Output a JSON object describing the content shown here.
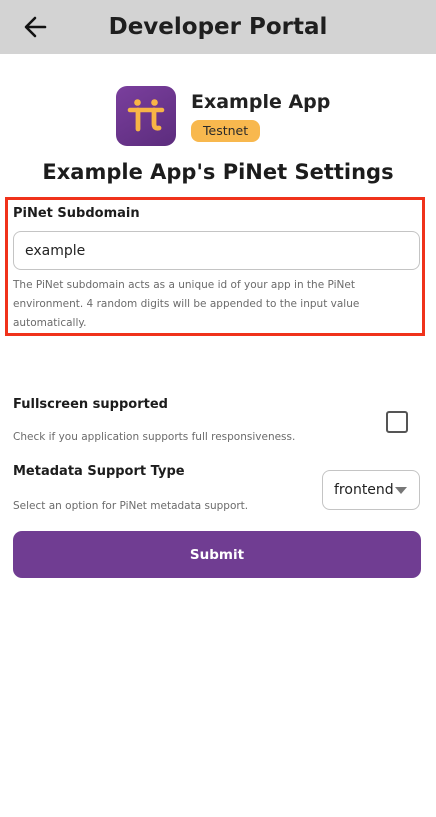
{
  "header": {
    "title": "Developer Portal",
    "back_icon": "arrow-left-icon"
  },
  "app": {
    "name": "Example App",
    "network_badge": "Testnet",
    "icon": "pi-logo-icon",
    "icon_bg_color": "#6a3590",
    "icon_fg_color": "#f7b546"
  },
  "page": {
    "title": "Example App's PiNet Settings"
  },
  "subdomain": {
    "label": "PiNet Subdomain",
    "value": "example",
    "help": "The PiNet subdomain acts as a unique id of your app in the PiNet environment. 4 random digits will be appended to the input value automatically."
  },
  "fullscreen": {
    "label": "Fullscreen supported",
    "help": "Check if you application supports full responsiveness.",
    "checked": false
  },
  "metadata": {
    "label": "Metadata Support Type",
    "help": "Select an option for PiNet metadata support.",
    "selected": "frontend"
  },
  "submit": {
    "label": "Submit"
  },
  "colors": {
    "accent": "#703d92",
    "badge": "#f8b84e",
    "highlight": "#f0321b",
    "header_bg": "#d3d3d3"
  }
}
